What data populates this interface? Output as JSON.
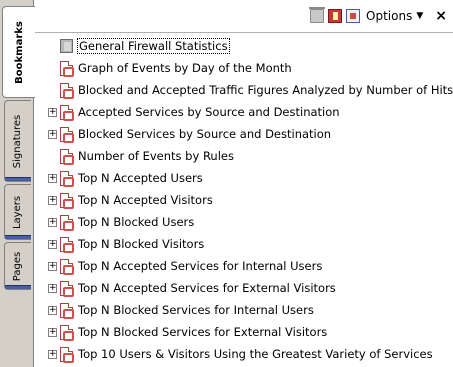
{
  "tabs": [
    {
      "label": "Bookmarks",
      "active": true
    },
    {
      "label": "Signatures",
      "active": false
    },
    {
      "label": "Layers",
      "active": false
    },
    {
      "label": "Pages",
      "active": false
    }
  ],
  "toolbar": {
    "options_label": "Options",
    "close_glyph": "×"
  },
  "bookmarks": [
    {
      "label": "General Firewall Statistics",
      "icon": "book-icon",
      "expandable": false,
      "selected": true
    },
    {
      "label": "Graph of Events by Day of the Month",
      "icon": "pdf-doc-icon",
      "expandable": false
    },
    {
      "label": "Blocked and Accepted Traffic Figures Analyzed by Number of Hits",
      "icon": "pdf-doc-icon",
      "expandable": false
    },
    {
      "label": "Accepted Services by Source and Destination",
      "icon": "pdf-doc-icon",
      "expandable": true
    },
    {
      "label": "Blocked Services by Source and Destination",
      "icon": "pdf-doc-icon",
      "expandable": true
    },
    {
      "label": "Number of Events by Rules",
      "icon": "pdf-doc-icon",
      "expandable": false
    },
    {
      "label": "Top N Accepted Users",
      "icon": "pdf-doc-icon",
      "expandable": true
    },
    {
      "label": "Top N Accepted Visitors",
      "icon": "pdf-doc-icon",
      "expandable": true
    },
    {
      "label": "Top N Blocked Users",
      "icon": "pdf-doc-icon",
      "expandable": true
    },
    {
      "label": "Top N Blocked Visitors",
      "icon": "pdf-doc-icon",
      "expandable": true
    },
    {
      "label": "Top N Accepted Services for Internal Users",
      "icon": "pdf-doc-icon",
      "expandable": true
    },
    {
      "label": "Top N Accepted Services for External Visitors",
      "icon": "pdf-doc-icon",
      "expandable": true
    },
    {
      "label": "Top N Blocked Services for Internal Users",
      "icon": "pdf-doc-icon",
      "expandable": true
    },
    {
      "label": "Top N Blocked Services for External Visitors",
      "icon": "pdf-doc-icon",
      "expandable": true
    },
    {
      "label": "Top 10 Users & Visitors Using the Greatest Variety of Services",
      "icon": "pdf-doc-icon",
      "expandable": true
    }
  ]
}
